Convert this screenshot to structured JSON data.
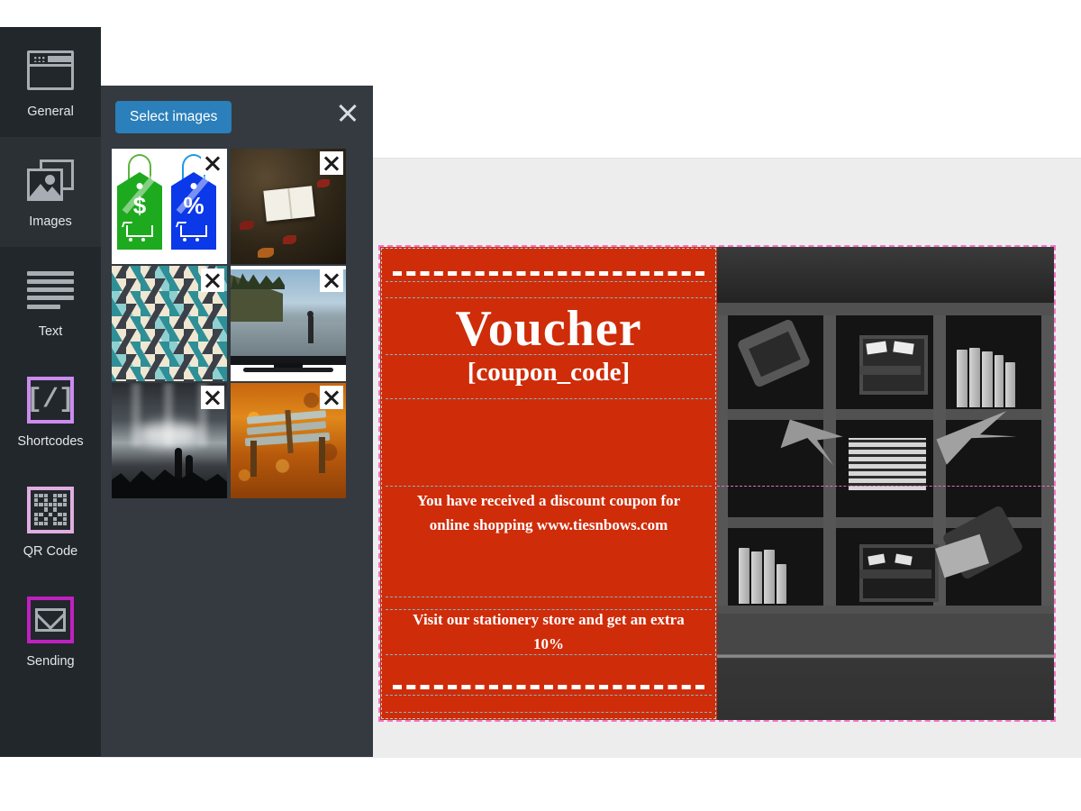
{
  "app": {
    "accent_blue": "#2b7fba",
    "voucher_red": "#cf2c0a",
    "rail_bg": "#22272b",
    "panel_bg": "#343a40"
  },
  "sidebar": {
    "items": [
      {
        "label": "General",
        "icon": "browser-window-icon",
        "selected": false
      },
      {
        "label": "Images",
        "icon": "images-icon",
        "selected": true
      },
      {
        "label": "Text",
        "icon": "text-lines-icon",
        "selected": false
      },
      {
        "label": "Shortcodes",
        "icon": "code-brackets-icon",
        "selected": true
      },
      {
        "label": "QR Code",
        "icon": "qr-code-icon",
        "selected": false
      },
      {
        "label": "Sending",
        "icon": "envelope-icon",
        "selected": false
      }
    ]
  },
  "picker": {
    "select_button_label": "Select images",
    "close_icon": "close-icon",
    "thumbnails": [
      {
        "name": "sale-tags-image",
        "remove_icon": "remove-icon"
      },
      {
        "name": "open-book-forest-image",
        "remove_icon": "remove-icon"
      },
      {
        "name": "geometric-pattern-image",
        "remove_icon": "remove-icon"
      },
      {
        "name": "tv-beach-image",
        "remove_icon": "remove-icon"
      },
      {
        "name": "concert-crowd-image",
        "remove_icon": "remove-icon"
      },
      {
        "name": "autumn-bench-image",
        "remove_icon": "remove-icon"
      }
    ]
  },
  "voucher": {
    "heading": "Voucher",
    "coupon_code": "[coupon_code]",
    "body_text": "You have received a discount coupon for online shopping www.tiesnbows.com",
    "offer_text": "Visit our stationery store and get an extra 10%",
    "photo_alt": "bookshelf-bowties-grayscale-image"
  }
}
